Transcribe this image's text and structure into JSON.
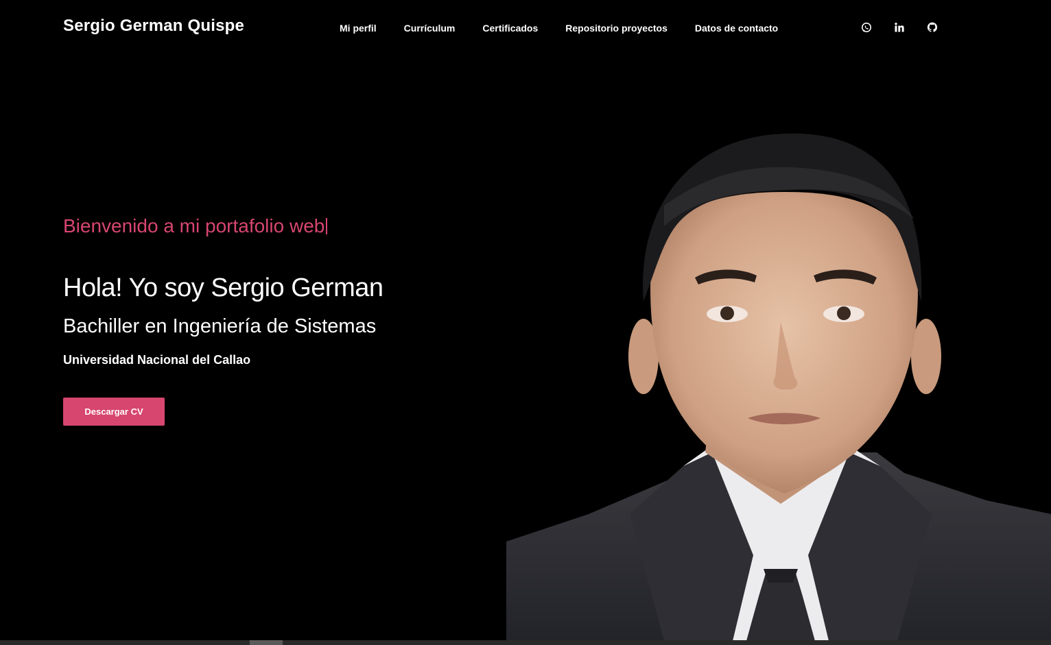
{
  "header": {
    "brand": "Sergio German Quispe",
    "nav": [
      {
        "label": "Mi perfil"
      },
      {
        "label": "Currículum"
      },
      {
        "label": "Certificados"
      },
      {
        "label": "Repositorio proyectos"
      },
      {
        "label": "Datos de contacto"
      }
    ],
    "social_icons": [
      "whatsapp-icon",
      "linkedin-icon",
      "github-icon"
    ]
  },
  "hero": {
    "welcome": "Bienvenido a mi portafolio web",
    "greeting": "Hola! Yo soy Sergio German",
    "degree": "Bachiller en Ingeniería de Sistemas",
    "university": "Universidad Nacional del Callao",
    "cv_button": "Descargar CV"
  },
  "colors": {
    "background": "#000000",
    "accent": "#d7466f",
    "text": "#ffffff"
  }
}
